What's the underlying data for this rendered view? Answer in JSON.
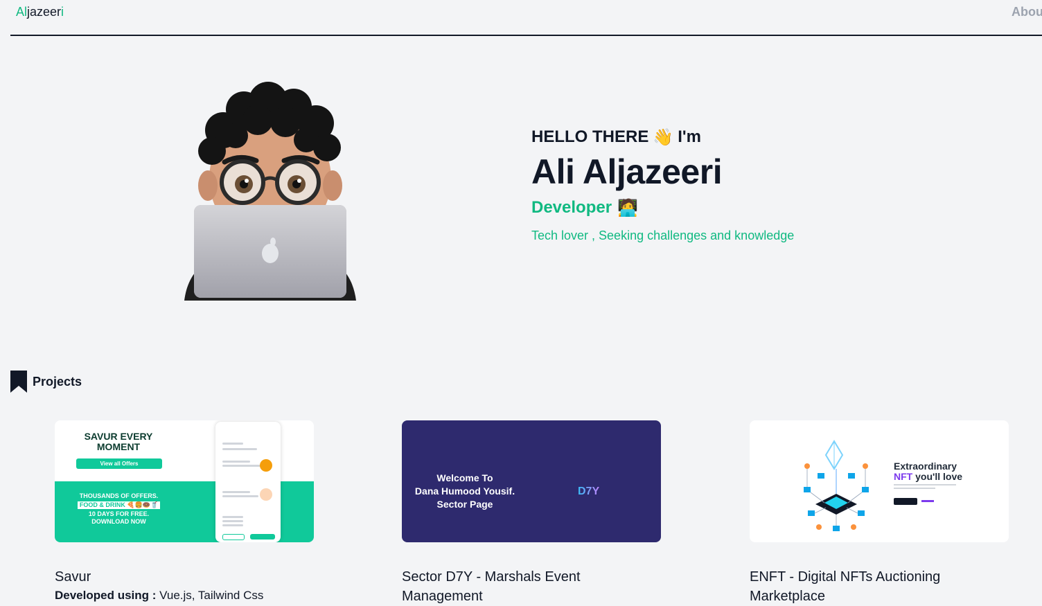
{
  "nav": {
    "logo_a": "Al",
    "logo_b": "jazeer",
    "logo_c": "i",
    "about": "About"
  },
  "hero": {
    "greeting": "HELLO THERE",
    "greeting_emoji": "👋",
    "greeting_suffix": "I'm",
    "name": "Ali Aljazeeri",
    "role": "Developer",
    "role_emoji": "🧑‍💻",
    "tagline": "Tech lover , Seeking challenges and knowledge"
  },
  "projects": {
    "title": "Projects",
    "items": [
      {
        "title": "Savur",
        "dev_label": "Developed using :",
        "dev_value": "Vue.js, Tailwind Css",
        "thumb": {
          "heading": "SAVUR EVERY MOMENT",
          "button": "View all Offers",
          "line1": "THOUSANDS OF OFFERS.",
          "pill": "FOOD & DRINK 🍕🍔🍩🥤",
          "line2": "10 DAYS FOR FREE.",
          "line3": "DOWNLOAD NOW"
        }
      },
      {
        "title": "Sector D7Y - Marshals Event Management",
        "thumb": {
          "line1": "Welcome To",
          "line2": "Dana Humood Yousif.",
          "line3": "Sector Page",
          "logo": "D7Y"
        }
      },
      {
        "title": "ENFT - Digital NFTs Auctioning Marketplace",
        "thumb": {
          "line1": "Extraordinary",
          "highlight": "NFT",
          "line2": "you'll love"
        }
      }
    ]
  },
  "colors": {
    "accent": "#10b981",
    "text": "#111827",
    "background": "#f3f4f6",
    "muted": "#9ca3af"
  }
}
